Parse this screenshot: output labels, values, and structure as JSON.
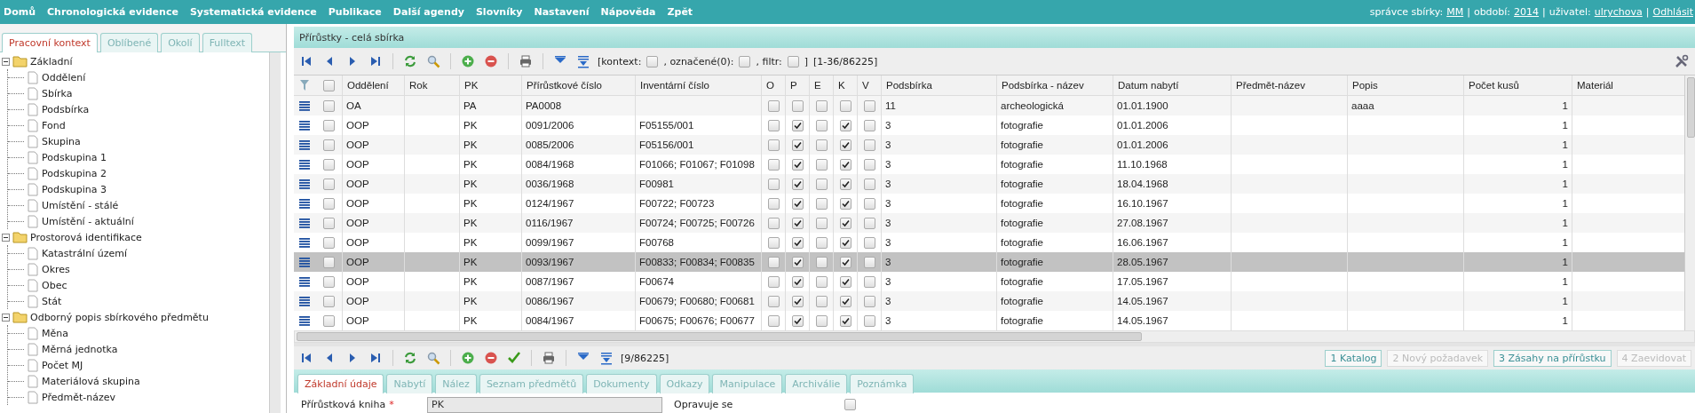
{
  "menu": {
    "items": [
      "Domů",
      "Chronologická evidence",
      "Systematická evidence",
      "Publikace",
      "Další agendy",
      "Slovníky",
      "Nastavení",
      "Nápověda",
      "Zpět"
    ],
    "user_info": [
      {
        "label": "správce sbírky:",
        "value": "MM"
      },
      {
        "label": "období:",
        "value": "2014"
      },
      {
        "label": "uživatel:",
        "value": "ulrychova"
      }
    ],
    "separator": "|",
    "logout": "Odhlásit"
  },
  "sidebar": {
    "tabs": [
      {
        "label": "Pracovní kontext",
        "selected": true
      },
      {
        "label": "Oblíbené",
        "selected": false
      },
      {
        "label": "Okolí",
        "selected": false
      },
      {
        "label": "Fulltext",
        "selected": false
      }
    ],
    "tree": [
      {
        "label": "Základní",
        "expanded": true,
        "children": [
          {
            "label": "Oddělení"
          },
          {
            "label": "Sbírka"
          },
          {
            "label": "Podsbírka"
          },
          {
            "label": "Fond"
          },
          {
            "label": "Skupina"
          },
          {
            "label": "Podskupina 1"
          },
          {
            "label": "Podskupina 2"
          },
          {
            "label": "Podskupina 3"
          },
          {
            "label": "Umístění - stálé"
          },
          {
            "label": "Umístění - aktuální"
          }
        ]
      },
      {
        "label": "Prostorová identifikace",
        "expanded": true,
        "children": [
          {
            "label": "Katastrální území"
          },
          {
            "label": "Okres"
          },
          {
            "label": "Obec"
          },
          {
            "label": "Stát"
          }
        ]
      },
      {
        "label": "Odborný popis sbírkového předmětu",
        "expanded": true,
        "children": [
          {
            "label": "Měna"
          },
          {
            "label": "Měrná jednotka"
          },
          {
            "label": "Počet MJ"
          },
          {
            "label": "Materiálová skupina"
          },
          {
            "label": "Předmět-název"
          }
        ]
      }
    ]
  },
  "panel": {
    "title": "Přírůstky - celá sbírka",
    "toolbar": {
      "filters": [
        {
          "label": "[kontext:",
          "checked": false
        },
        {
          "label": ", označené(0):",
          "checked": false
        },
        {
          "label": ", filtr:",
          "checked": false
        }
      ],
      "filters_end": "]",
      "range": "[1-36/86225]"
    },
    "table": {
      "all_checked": false,
      "columns": [
        {
          "label": "Oddělení",
          "kind": "text"
        },
        {
          "label": "Rok",
          "kind": "text"
        },
        {
          "label": "PK",
          "kind": "text"
        },
        {
          "label": "Přírůstkové číslo",
          "kind": "text"
        },
        {
          "label": "Inventární číslo",
          "kind": "text"
        },
        {
          "label": "O",
          "kind": "flag"
        },
        {
          "label": "P",
          "kind": "flag"
        },
        {
          "label": "E",
          "kind": "flag"
        },
        {
          "label": "K",
          "kind": "flag"
        },
        {
          "label": "V",
          "kind": "flag"
        },
        {
          "label": "Podsbírka",
          "kind": "text"
        },
        {
          "label": "Podsbírka - název",
          "kind": "text"
        },
        {
          "label": "Datum nabytí",
          "kind": "text"
        },
        {
          "label": "Předmět-název",
          "kind": "text"
        },
        {
          "label": "Popis",
          "kind": "text"
        },
        {
          "label": "Počet kusů",
          "kind": "number"
        },
        {
          "label": "Materiál",
          "kind": "text"
        }
      ],
      "rows": [
        {
          "selected": false,
          "checked": false,
          "cells": [
            "OA",
            null,
            "PA",
            "PA0008",
            null,
            false,
            false,
            false,
            false,
            false,
            "11",
            "archeologická",
            "01.01.1900",
            null,
            "aaaa",
            "1",
            null
          ]
        },
        {
          "selected": false,
          "checked": false,
          "cells": [
            "OOP",
            null,
            "PK",
            "0091/2006",
            "F05155/001",
            false,
            true,
            false,
            true,
            false,
            "3",
            "fotografie",
            "01.01.2006",
            null,
            null,
            "1",
            null
          ]
        },
        {
          "selected": false,
          "checked": false,
          "cells": [
            "OOP",
            null,
            "PK",
            "0085/2006",
            "F05156/001",
            false,
            true,
            false,
            true,
            false,
            "3",
            "fotografie",
            "01.01.2006",
            null,
            null,
            "1",
            null
          ]
        },
        {
          "selected": false,
          "checked": false,
          "cells": [
            "OOP",
            null,
            "PK",
            "0084/1968",
            "F01066; F01067; F01098",
            false,
            true,
            false,
            true,
            false,
            "3",
            "fotografie",
            "11.10.1968",
            null,
            null,
            "1",
            null
          ]
        },
        {
          "selected": false,
          "checked": false,
          "cells": [
            "OOP",
            null,
            "PK",
            "0036/1968",
            "F00981",
            false,
            true,
            false,
            true,
            false,
            "3",
            "fotografie",
            "18.04.1968",
            null,
            null,
            "1",
            null
          ]
        },
        {
          "selected": false,
          "checked": false,
          "cells": [
            "OOP",
            null,
            "PK",
            "0124/1967",
            "F00722; F00723",
            false,
            true,
            false,
            true,
            false,
            "3",
            "fotografie",
            "16.10.1967",
            null,
            null,
            "1",
            null
          ]
        },
        {
          "selected": false,
          "checked": false,
          "cells": [
            "OOP",
            null,
            "PK",
            "0116/1967",
            "F00724; F00725; F00726",
            false,
            true,
            false,
            true,
            false,
            "3",
            "fotografie",
            "27.08.1967",
            null,
            null,
            "1",
            null
          ]
        },
        {
          "selected": false,
          "checked": false,
          "cells": [
            "OOP",
            null,
            "PK",
            "0099/1967",
            "F00768",
            false,
            true,
            false,
            true,
            false,
            "3",
            "fotografie",
            "16.06.1967",
            null,
            null,
            "1",
            null
          ]
        },
        {
          "selected": true,
          "checked": false,
          "cells": [
            "OOP",
            null,
            "PK",
            "0093/1967",
            "F00833; F00834; F00835",
            false,
            true,
            false,
            true,
            false,
            "3",
            "fotografie",
            "28.05.1967",
            null,
            null,
            "1",
            null
          ]
        },
        {
          "selected": false,
          "checked": false,
          "cells": [
            "OOP",
            null,
            "PK",
            "0087/1967",
            "F00674",
            false,
            true,
            false,
            true,
            false,
            "3",
            "fotografie",
            "17.05.1967",
            null,
            null,
            "1",
            null
          ]
        },
        {
          "selected": false,
          "checked": false,
          "cells": [
            "OOP",
            null,
            "PK",
            "0086/1967",
            "F00679; F00680; F00681",
            false,
            true,
            false,
            true,
            false,
            "3",
            "fotografie",
            "14.05.1967",
            null,
            null,
            "1",
            null
          ]
        },
        {
          "selected": false,
          "checked": false,
          "cells": [
            "OOP",
            null,
            "PK",
            "0084/1967",
            "F00675; F00676; F00677",
            false,
            true,
            false,
            true,
            false,
            "3",
            "fotografie",
            "14.05.1967",
            null,
            null,
            "1",
            null
          ]
        }
      ]
    },
    "pager": "[9/86225]",
    "actions": [
      {
        "label": "1 Katalog",
        "disabled": false
      },
      {
        "label": "2 Nový požadavek",
        "disabled": true
      },
      {
        "label": "3 Zásahy na přírůstku",
        "disabled": false
      },
      {
        "label": "4 Zaevidovat",
        "disabled": true
      }
    ],
    "detail_tabs": [
      {
        "label": "Základní údaje",
        "selected": true
      },
      {
        "label": "Nabytí",
        "selected": false
      },
      {
        "label": "Nález",
        "selected": false
      },
      {
        "label": "Seznam předmětů",
        "selected": false
      },
      {
        "label": "Dokumenty",
        "selected": false
      },
      {
        "label": "Odkazy",
        "selected": false
      },
      {
        "label": "Manipulace",
        "selected": false
      },
      {
        "label": "Archiválie",
        "selected": false
      },
      {
        "label": "Poznámka",
        "selected": false
      }
    ],
    "form": [
      {
        "kind": "text",
        "label": "Přírůstková kniha",
        "required_mark": "*",
        "value": "PK"
      },
      {
        "kind": "checkbox",
        "label": "Opravuje se",
        "checked": false
      }
    ]
  }
}
